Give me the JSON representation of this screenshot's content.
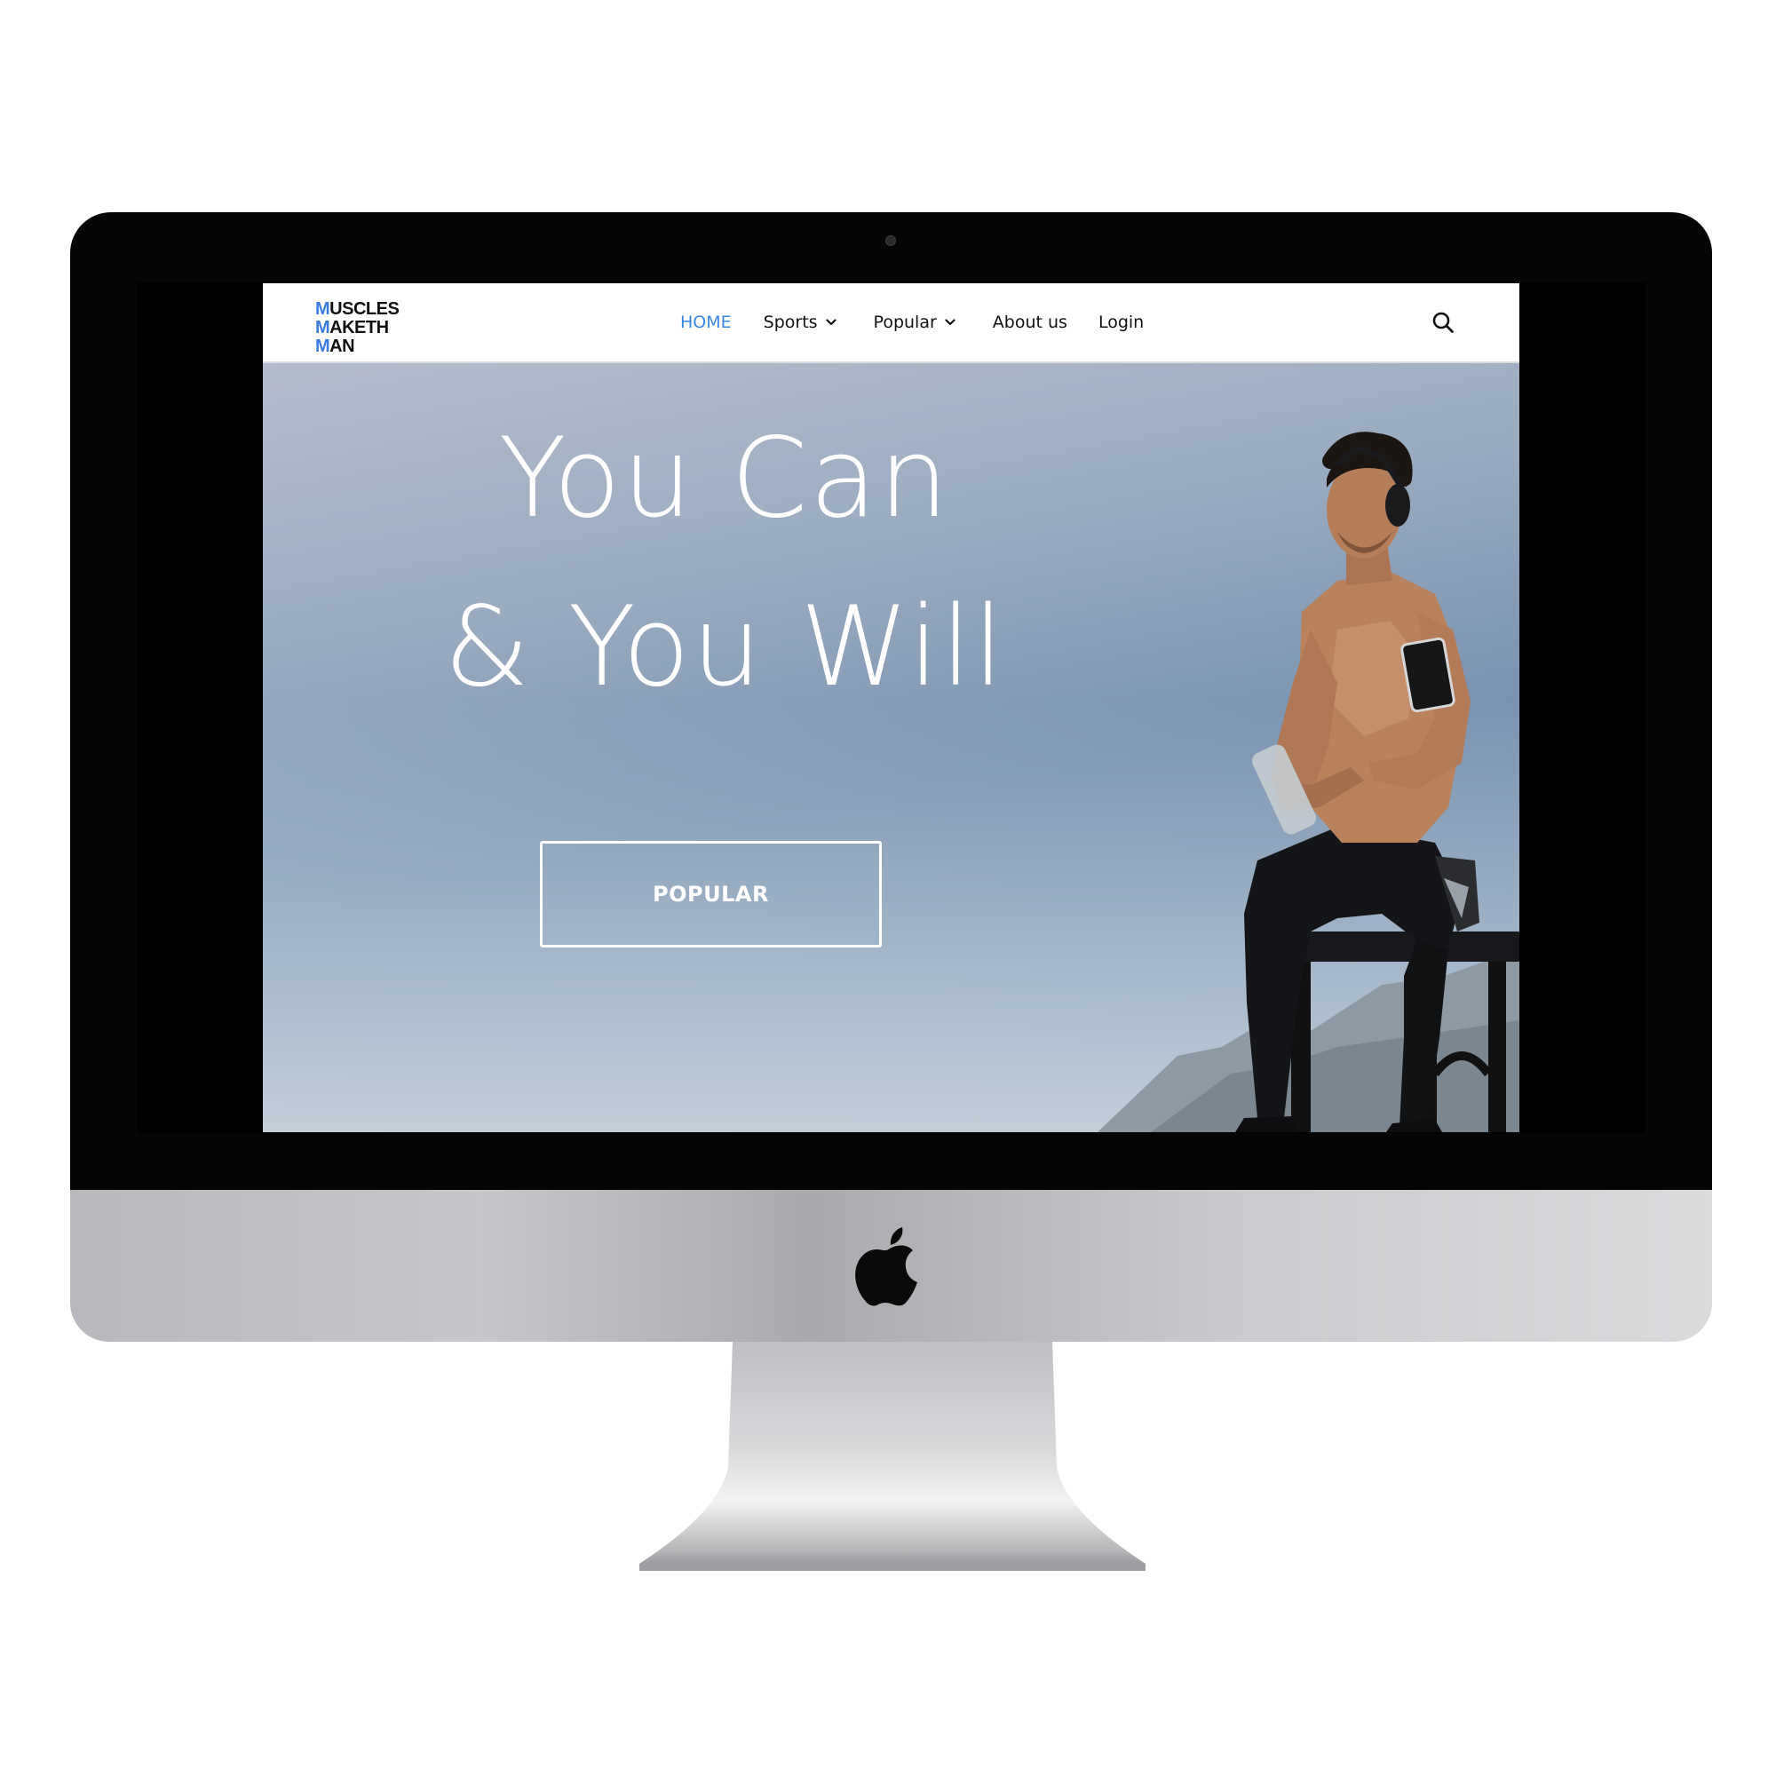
{
  "site": {
    "logo": {
      "lines": [
        {
          "first": "M",
          "rest": "USCLES"
        },
        {
          "first": "M",
          "rest": "AKETH"
        },
        {
          "first": "M",
          "rest": "AN"
        }
      ]
    },
    "nav": {
      "items": [
        {
          "label": "HOME",
          "active": true,
          "dropdown": false
        },
        {
          "label": "Sports",
          "active": false,
          "dropdown": true
        },
        {
          "label": "Popular",
          "active": false,
          "dropdown": true
        },
        {
          "label": "About us",
          "active": false,
          "dropdown": false
        },
        {
          "label": "Login",
          "active": false,
          "dropdown": false
        }
      ],
      "search_icon": "search-icon"
    },
    "hero": {
      "headline_line1": "You Can",
      "headline_line2": "& You Will",
      "cta_label": "POPULAR"
    }
  },
  "colors": {
    "accent": "#3a86e6",
    "bezel": "#050505",
    "text_dark": "#111111",
    "hero_sky": "#7a93b0"
  }
}
